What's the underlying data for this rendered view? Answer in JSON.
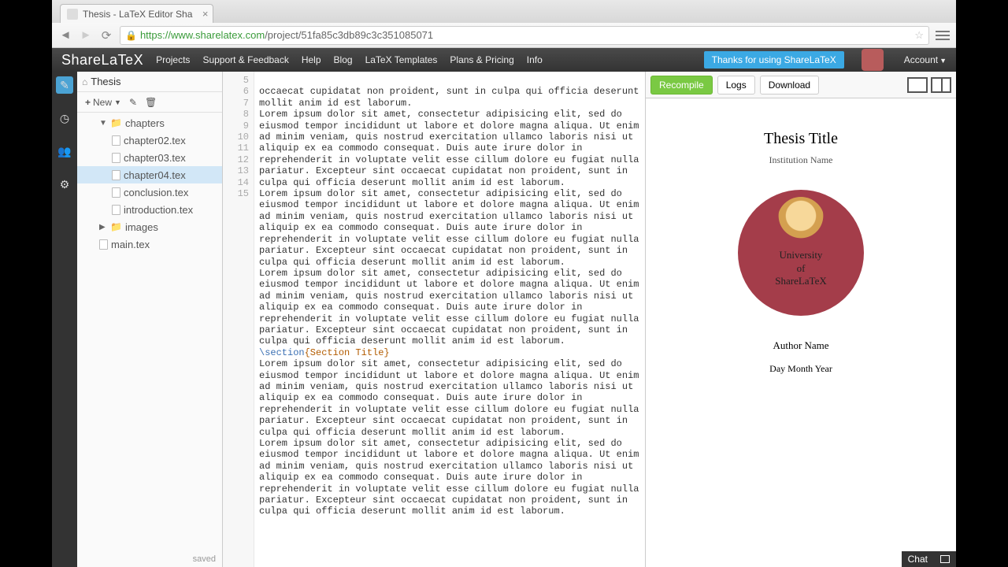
{
  "browser": {
    "tab_title": "Thesis - LaTeX Editor Sha",
    "url_host": "https://www.sharelatex.com",
    "url_path": "/project/51fa85c3db89c3c351085071"
  },
  "header": {
    "logo": "ShareLaTeX",
    "nav": [
      "Projects",
      "Support & Feedback",
      "Help",
      "Blog",
      "LaTeX Templates",
      "Plans & Pricing",
      "Info"
    ],
    "thanks": "Thanks for using ShareLaTeX",
    "account": "Account"
  },
  "project": {
    "name": "Thesis",
    "new_label": "New",
    "saved": "saved"
  },
  "tree": {
    "chapters_label": "chapters",
    "images_label": "images",
    "files": {
      "chapter02": "chapter02.tex",
      "chapter03": "chapter03.tex",
      "chapter04": "chapter04.tex",
      "conclusion": "conclusion.tex",
      "introduction": "introduction.tex",
      "main": "main.tex"
    }
  },
  "editor": {
    "lines": {
      "l4a": "occaecat cupidatat non proident, sunt in culpa qui officia deserunt",
      "l4b": "mollit anim id est laborum.",
      "l5": "",
      "l6": "Lorem ipsum dolor sit amet, consectetur adipisicing elit, sed do eiusmod tempor incididunt ut labore et dolore magna aliqua. Ut enim ad minim veniam, quis nostrud exercitation ullamco laboris nisi ut aliquip ex ea commodo consequat. Duis aute irure dolor in reprehenderit in voluptate velit esse cillum dolore eu fugiat nulla pariatur. Excepteur sint occaecat cupidatat non proident, sunt in culpa qui officia deserunt mollit anim id est laborum.",
      "l7": "",
      "l8": "Lorem ipsum dolor sit amet, consectetur adipisicing elit, sed do eiusmod tempor incididunt ut labore et dolore magna aliqua. Ut enim ad minim veniam, quis nostrud exercitation ullamco laboris nisi ut aliquip ex ea commodo consequat. Duis aute irure dolor in reprehenderit in voluptate velit esse cillum dolore eu fugiat nulla pariatur. Excepteur sint occaecat cupidatat non proident, sunt in culpa qui officia deserunt mollit anim id est laborum.",
      "l9": "",
      "l10": "Lorem ipsum dolor sit amet, consectetur adipisicing elit, sed do eiusmod tempor incididunt ut labore et dolore magna aliqua. Ut enim ad minim veniam, quis nostrud exercitation ullamco laboris nisi ut aliquip ex ea commodo consequat. Duis aute irure dolor in reprehenderit in voluptate velit esse cillum dolore eu fugiat nulla pariatur. Excepteur sint occaecat cupidatat non proident, sunt in culpa qui officia deserunt mollit anim id est laborum.",
      "l11": "",
      "section_cmd": "\\section",
      "section_title": "{Section Title}",
      "l13": "Lorem ipsum dolor sit amet, consectetur adipisicing elit, sed do eiusmod tempor incididunt ut labore et dolore magna aliqua. Ut enim ad minim veniam, quis nostrud exercitation ullamco laboris nisi ut aliquip ex ea commodo consequat. Duis aute irure dolor in reprehenderit in voluptate velit esse cillum dolore eu fugiat nulla pariatur. Excepteur sint occaecat cupidatat non proident, sunt in culpa qui officia deserunt mollit anim id est laborum.",
      "l14": "",
      "l15": "Lorem ipsum dolor sit amet, consectetur adipisicing elit, sed do eiusmod tempor incididunt ut labore et dolore magna aliqua. Ut enim ad minim veniam, quis nostrud exercitation ullamco laboris nisi ut aliquip ex ea commodo consequat. Duis aute irure dolor in reprehenderit in voluptate velit esse cillum dolore eu fugiat nulla pariatur. Excepteur sint occaecat cupidatat non proident, sunt in culpa qui officia deserunt mollit anim id est laborum."
    },
    "numbers": [
      "",
      "",
      "5",
      "6",
      "",
      "",
      "",
      "",
      "",
      "",
      "7",
      "8",
      "",
      "",
      "",
      "",
      "",
      "",
      "9",
      "10",
      "",
      "",
      "",
      "",
      "",
      "",
      "11",
      "12",
      "13",
      "",
      "",
      "",
      "",
      "",
      "",
      "14",
      "15",
      "",
      "",
      "",
      "",
      "",
      ""
    ]
  },
  "pdf": {
    "recompile": "Recompile",
    "logs": "Logs",
    "download": "Download",
    "title": "Thesis Title",
    "institution": "Institution Name",
    "uni1": "University",
    "uni2": "of",
    "uni3": "ShareLaTeX",
    "author": "Author Name",
    "date": "Day Month Year"
  },
  "chat": {
    "label": "Chat"
  }
}
